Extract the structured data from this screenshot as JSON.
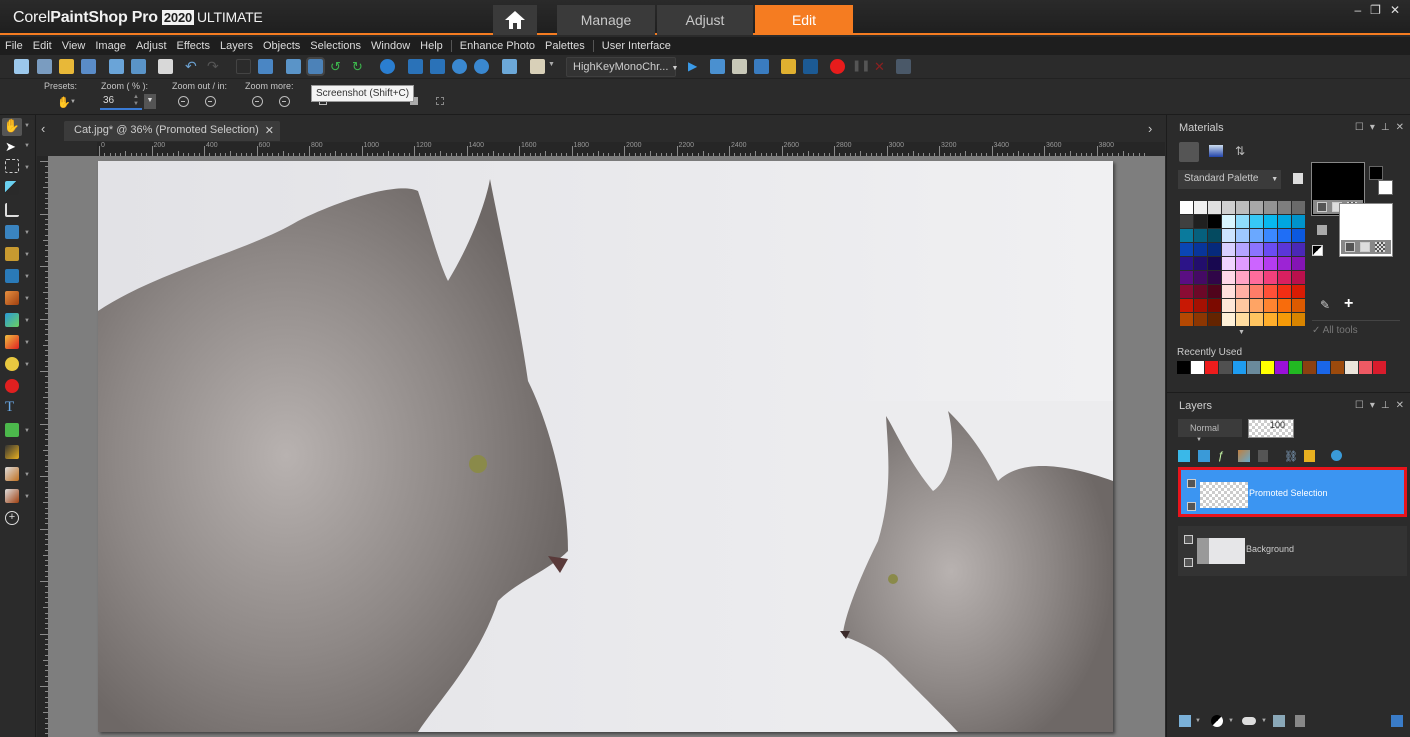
{
  "app": {
    "brand_prefix": "Corel",
    "brand_name": "PaintShop Pro",
    "brand_year": "2020",
    "brand_edition": "ULTIMATE"
  },
  "workspace_tabs": [
    {
      "label": "Manage",
      "active": false
    },
    {
      "label": "Adjust",
      "active": false
    },
    {
      "label": "Edit",
      "active": true
    }
  ],
  "window_controls": {
    "minimize": "–",
    "restore": "❐",
    "close": "✕"
  },
  "menu": [
    "File",
    "Edit",
    "View",
    "Image",
    "Adjust",
    "Effects",
    "Layers",
    "Objects",
    "Selections",
    "Window",
    "Help",
    "Enhance Photo",
    "Palettes",
    "User Interface"
  ],
  "toolbar": {
    "script_select": "HighKeyMonoChr...",
    "tooltip": "Screenshot (Shift+C)"
  },
  "tool_options": {
    "presets_label": "Presets:",
    "zoom_label": "Zoom ( % ):",
    "zoom_value": "36",
    "zoom_out_in_label": "Zoom out / in:",
    "zoom_more_label": "Zoom more:"
  },
  "document": {
    "tab_title": "Cat.jpg* @  36% (Promoted Selection)",
    "close": "✕",
    "nav_prev": "‹",
    "nav_next": "›"
  },
  "ruler": {
    "labels": [
      "0",
      "200",
      "400",
      "600",
      "800",
      "1000",
      "1200",
      "1400",
      "1600",
      "1800",
      "2000",
      "2200",
      "2400",
      "2600",
      "2800",
      "3000",
      "3200",
      "3400",
      "3600",
      "3800"
    ]
  },
  "materials": {
    "title": "Materials",
    "palette_select": "Standard Palette",
    "all_tools_label": "All tools",
    "recently_used_label": "Recently Used",
    "foreground": "#000000",
    "background": "#ffffff",
    "palette_colors": [
      [
        "#ffffff",
        "#f0f0f0",
        "#e0e0e0",
        "#d0d0d0",
        "#bdbdbd",
        "#a8a8a8",
        "#939393",
        "#7e7e7e",
        "#6a6a6a"
      ],
      [
        "#404040",
        "#202020",
        "#000000",
        "#d8f6ff",
        "#8fdcfb",
        "#37c8f5",
        "#08b8ee",
        "#00a6e0",
        "#0094cc"
      ],
      [
        "#0a7a9c",
        "#06607d",
        "#044a60",
        "#cce4ff",
        "#9ec8ff",
        "#6aa8ff",
        "#3b88ff",
        "#1f6ef6",
        "#0b58de"
      ],
      [
        "#0a46b4",
        "#08359a",
        "#062a7c",
        "#d8d0ff",
        "#b4a4ff",
        "#8c74ff",
        "#6a4cf2",
        "#5b36d8",
        "#4a28b6"
      ],
      [
        "#2c1488",
        "#220e6c",
        "#180850",
        "#f0d4ff",
        "#e09cff",
        "#cc64ff",
        "#b43cf0",
        "#9c24d4",
        "#8414b4"
      ],
      [
        "#5a0e82",
        "#440a64",
        "#300648",
        "#ffd8e8",
        "#ffa4c4",
        "#ff6c9c",
        "#f2407c",
        "#d82060",
        "#b8104c"
      ],
      [
        "#8a0c34",
        "#6c0828",
        "#50041c",
        "#ffe0dc",
        "#ffb0a4",
        "#ff7c68",
        "#ff5038",
        "#f22e14",
        "#d81c04"
      ],
      [
        "#c81804",
        "#a41002",
        "#7c0a00",
        "#ffe8d8",
        "#ffc8a0",
        "#ffa464",
        "#ff8430",
        "#f86c0c",
        "#dc5a00"
      ],
      [
        "#b44802",
        "#8c3602",
        "#642400",
        "#fff0d8",
        "#ffdca0",
        "#ffc460",
        "#ffae2c",
        "#f69a08",
        "#d88400"
      ]
    ],
    "recent_colors": [
      "#000000",
      "#ffffff",
      "#ee1c1c",
      "#505050",
      "#1e9cf0",
      "#6a8a9c",
      "#ffff00",
      "#9a10d8",
      "#22b822",
      "#8c4010",
      "#1a66e8",
      "#9c4a0c",
      "#ece6dc",
      "#ee5a64",
      "#d81c2c"
    ]
  },
  "layers": {
    "title": "Layers",
    "blend_mode": "Normal",
    "opacity": "100",
    "items": [
      {
        "name": "Promoted Selection",
        "selected": true
      },
      {
        "name": "Background",
        "selected": false
      }
    ]
  },
  "colors": {
    "accent": "#f57c21",
    "selection_blue": "#3b95f2",
    "highlight_red": "#e8141c"
  }
}
